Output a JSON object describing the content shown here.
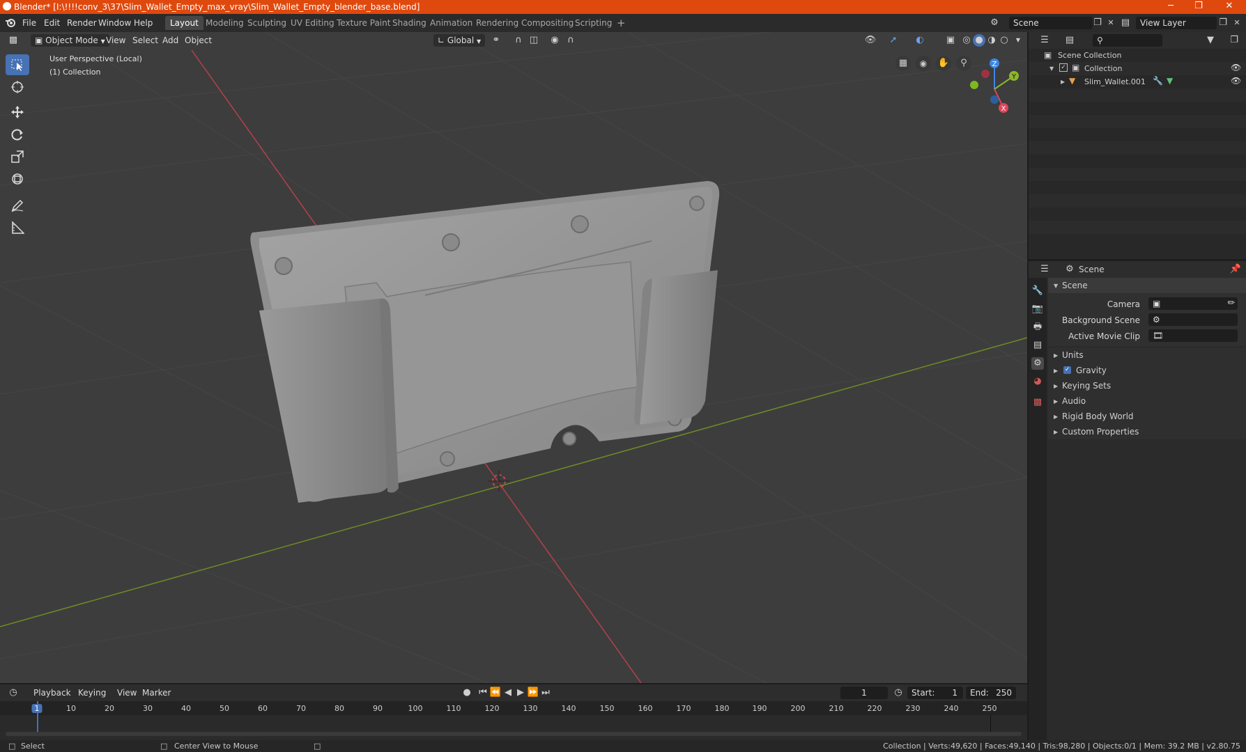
{
  "window": {
    "title": "Blender* [I:\\!!!!conv_3\\37\\Slim_Wallet_Empty_max_vray\\Slim_Wallet_Empty_blender_base.blend]",
    "minimize": "─",
    "restore": "❐",
    "close": "✕"
  },
  "menu": [
    "File",
    "Edit",
    "Render",
    "Window",
    "Help"
  ],
  "workspaces": [
    "Layout",
    "Modeling",
    "Sculpting",
    "UV Editing",
    "Texture Paint",
    "Shading",
    "Animation",
    "Rendering",
    "Compositing",
    "Scripting"
  ],
  "workspace_add": "+",
  "scene_name": "Scene",
  "view_layer": "View Layer",
  "viewport_header": {
    "mode": "Object Mode",
    "menus": [
      "View",
      "Select",
      "Add",
      "Object"
    ],
    "transform": "Global"
  },
  "viewport": {
    "perspective": "User Perspective (Local)",
    "collection": "(1) Collection",
    "gizmo": {
      "z": "Z",
      "y": "Y",
      "x": "X"
    }
  },
  "outliner": {
    "root": "Scene Collection",
    "collection": "Collection",
    "object": "Slim_Wallet.001"
  },
  "properties": {
    "header": "Scene",
    "panel": "Scene",
    "camera_label": "Camera",
    "background_scene_label": "Background Scene",
    "active_movie_clip_label": "Active Movie Clip",
    "subpanels": [
      "Units",
      "Gravity",
      "Keying Sets",
      "Audio",
      "Rigid Body World",
      "Custom Properties"
    ],
    "gravity_checked": true
  },
  "timeline": {
    "menus": [
      "Playback",
      "Keying",
      "View",
      "Marker"
    ],
    "current_frame": "1",
    "start_label": "Start:",
    "start": "1",
    "end_label": "End:",
    "end": "250",
    "ticks": [
      "1",
      "10",
      "20",
      "30",
      "40",
      "50",
      "60",
      "70",
      "80",
      "90",
      "100",
      "110",
      "120",
      "130",
      "140",
      "150",
      "160",
      "170",
      "180",
      "190",
      "200",
      "210",
      "220",
      "230",
      "240",
      "250"
    ]
  },
  "status": {
    "select": "Select",
    "center_view": "Center View to Mouse",
    "stats": "Collection | Verts:49,620 | Faces:49,140 | Tris:98,280 | Objects:0/1 | Mem: 39.2 MB | v2.80.75"
  },
  "colors": {
    "titlebar": "#e0490e",
    "accent": "#4772b3",
    "x_axis": "#e2455a",
    "y_axis": "#8bb82a",
    "z_axis": "#3b87e4"
  }
}
